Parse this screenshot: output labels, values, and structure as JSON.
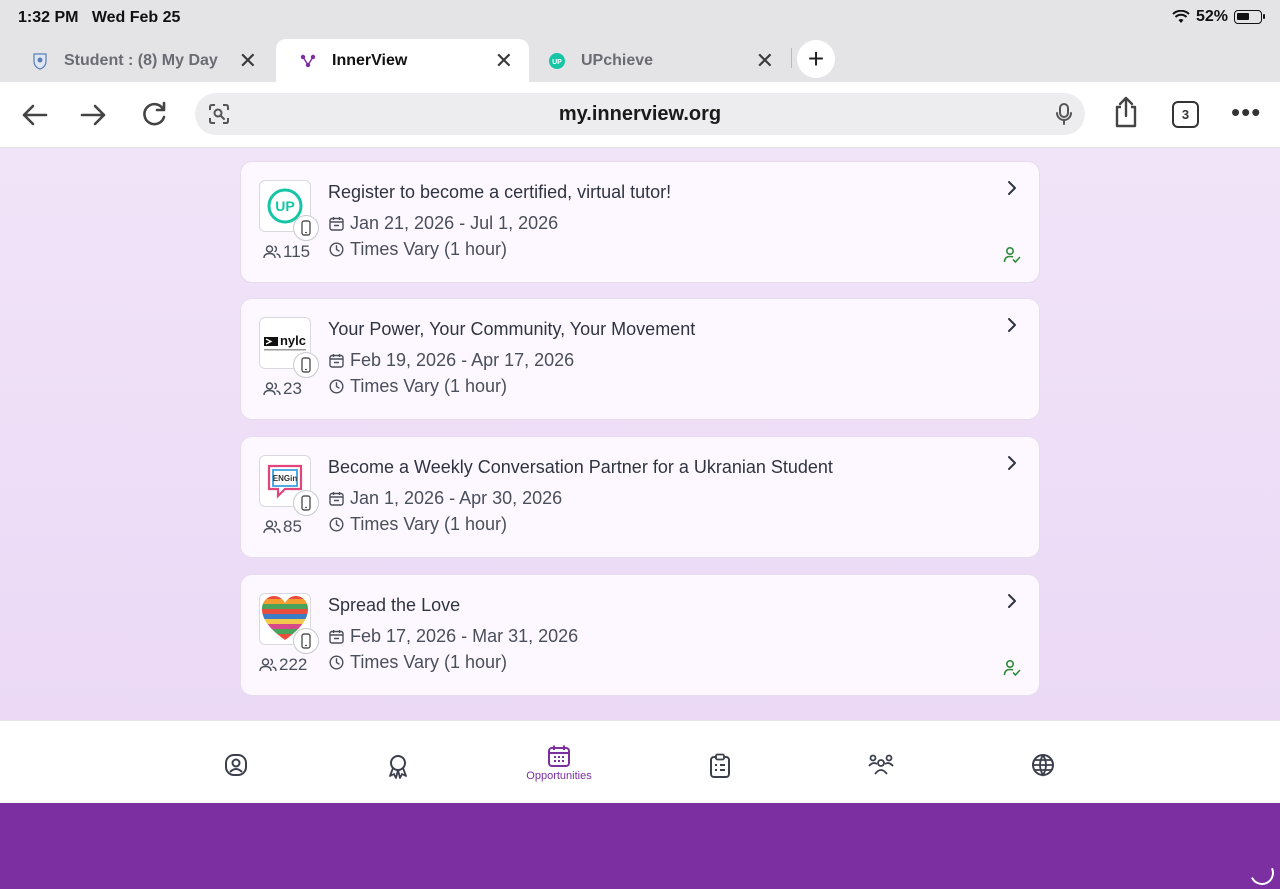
{
  "status_bar": {
    "time": "1:32 PM",
    "date": "Wed Feb 25",
    "battery": "52%"
  },
  "tabs": [
    {
      "title": "Student : (8) My Day",
      "icon": "school-crest-icon",
      "active": false
    },
    {
      "title": "InnerView",
      "icon": "innerview-logo-icon",
      "active": true
    },
    {
      "title": "UPchieve",
      "icon": "upchieve-logo-icon",
      "active": false
    }
  ],
  "toolbar": {
    "url": "my.innerview.org",
    "tab_count": "3"
  },
  "opportunities": [
    {
      "title": "Register to become a certified, virtual tutor!",
      "dates": "Jan 21, 2026 - Jul 1, 2026",
      "times": "Times Vary (1 hour)",
      "participants": "115",
      "logo_text": "UP",
      "registered": true
    },
    {
      "title": "Your Power, Your Community, Your Movement",
      "dates": "Feb 19, 2026 - Apr 17, 2026",
      "times": "Times Vary (1 hour)",
      "participants": "23",
      "logo_text": "nylc",
      "registered": false
    },
    {
      "title": "Become a Weekly Conversation Partner for a Ukranian Student",
      "dates": "Jan 1, 2026 - Apr 30, 2026",
      "times": "Times Vary (1 hour)",
      "participants": "85",
      "logo_text": "ENGin",
      "registered": false
    },
    {
      "title": "Spread the Love",
      "dates": "Feb 17, 2026 - Mar 31, 2026",
      "times": "Times Vary (1 hour)",
      "participants": "222",
      "logo_text": "",
      "registered": true
    }
  ],
  "bottom_nav": {
    "active_label": "Opportunities"
  },
  "colors": {
    "brand": "#7b2fa0",
    "registered": "#2e8b3a",
    "upchieve": "#16c5a5"
  }
}
